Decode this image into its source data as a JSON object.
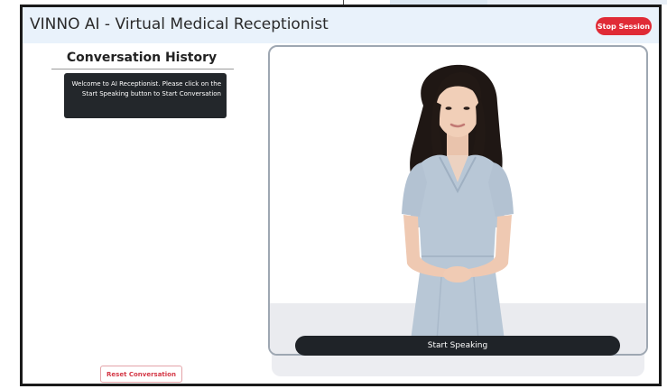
{
  "header": {
    "title": "VINNO AI - Virtual Medical Receptionist",
    "stop_label": "Stop Session"
  },
  "history": {
    "title": "Conversation History",
    "messages": [
      {
        "text": "Welcome to AI Receptionist. Please click on the Start Speaking button to Start Conversation"
      }
    ],
    "reset_label": "Reset Conversation"
  },
  "avatar": {
    "icon": "female-receptionist-avatar",
    "start_label": "Start Speaking"
  },
  "colors": {
    "header_bg": "#e9f2fb",
    "stop_button": "#e02b36",
    "bubble_bg": "#23272b",
    "start_button": "#1f2328",
    "reset_text": "#d43846"
  }
}
